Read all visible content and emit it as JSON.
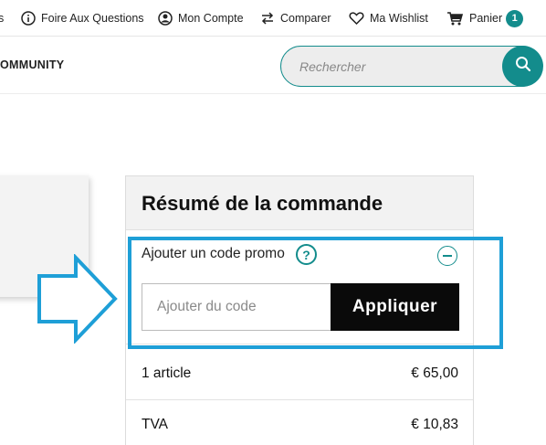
{
  "topbar": {
    "cut_s": "s",
    "faq": "Foire Aux Questions",
    "account": "Mon Compte",
    "compare": "Comparer",
    "wishlist": "Ma Wishlist",
    "cart": "Panier",
    "cart_count": "1"
  },
  "nav": {
    "community": "OMMUNITY",
    "search_placeholder": "Rechercher"
  },
  "summary": {
    "title": "Résumé de la commande",
    "promo_label": "Ajouter un code promo",
    "help_glyph": "?",
    "code_placeholder": "Ajouter du code",
    "apply_label": "Appliquer",
    "rows": [
      {
        "label": "1 article",
        "value": "€ 65,00"
      },
      {
        "label": "TVA",
        "value": "€ 10,83"
      }
    ]
  },
  "colors": {
    "accent": "#138c8c",
    "highlight": "#1e9fd7",
    "button_dark": "#0a0a0a"
  },
  "icons": [
    "info-icon",
    "user-icon",
    "compare-arrows-icon",
    "heart-icon",
    "cart-icon",
    "search-icon",
    "help-icon",
    "minus-icon",
    "arrow-right-icon"
  ]
}
